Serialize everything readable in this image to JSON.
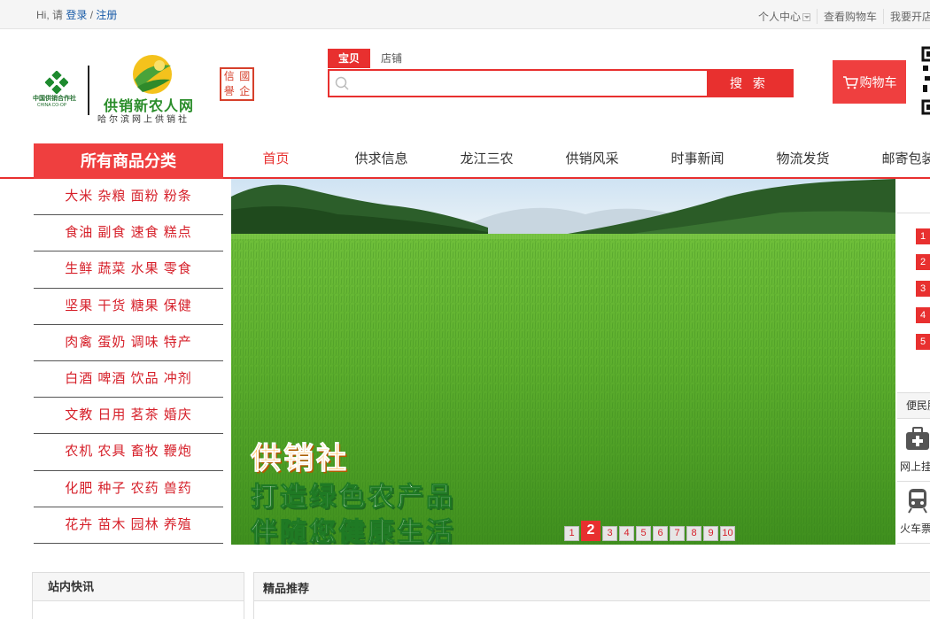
{
  "topbar": {
    "greeting": "Hi, 请 ",
    "login": "登录",
    "sep": " / ",
    "register": "注册",
    "links": [
      "个人中心",
      "查看购物车",
      "我要开店"
    ]
  },
  "header": {
    "coop_name": "中国供销合作社",
    "coop_sub": "CHINA CO-OP",
    "site_name": "供销新农人网",
    "site_sub": "哈尔滨网上供销社",
    "seal_chars": [
      "信",
      "國",
      "譽",
      "企"
    ]
  },
  "search": {
    "tabs": [
      "宝贝",
      "店铺"
    ],
    "placeholder": "",
    "button": "搜 索"
  },
  "cart": {
    "label": "购物车"
  },
  "nav": {
    "all_categories": "所有商品分类",
    "items": [
      "首页",
      "供求信息",
      "龙江三农",
      "供销风采",
      "时事新闻",
      "物流发货",
      "邮寄包装"
    ]
  },
  "categories": [
    "大米 杂粮 面粉 粉条",
    "食油 副食 速食 糕点",
    "生鲜 蔬菜 水果 零食",
    "坚果 干货 糖果 保健",
    "肉禽 蛋奶 调味 特产",
    "白酒 啤酒 饮品 冲剂",
    "文教 日用 茗茶 婚庆",
    "农机 农具 畜牧 鞭炮",
    "化肥 种子 农药 兽药",
    "花卉 苗木 园林 养殖"
  ],
  "banner": {
    "line1": "供销社",
    "line2": "打造绿色农产品",
    "line3": "伴随您健康生活",
    "pages": [
      "1",
      "2",
      "3",
      "4",
      "5",
      "6",
      "7",
      "8",
      "9",
      "10"
    ],
    "active_page": "2"
  },
  "side": {
    "ranks": [
      "1",
      "2",
      "3",
      "4",
      "5"
    ],
    "convenience": "便民服务",
    "services": [
      "网上挂号",
      "火车票"
    ]
  },
  "panels": {
    "news": "站内快讯",
    "featured": "精品推荐"
  },
  "colors": {
    "accent": "#e8302f",
    "category_text": "#d6202a",
    "green": "#2a8d2a"
  }
}
